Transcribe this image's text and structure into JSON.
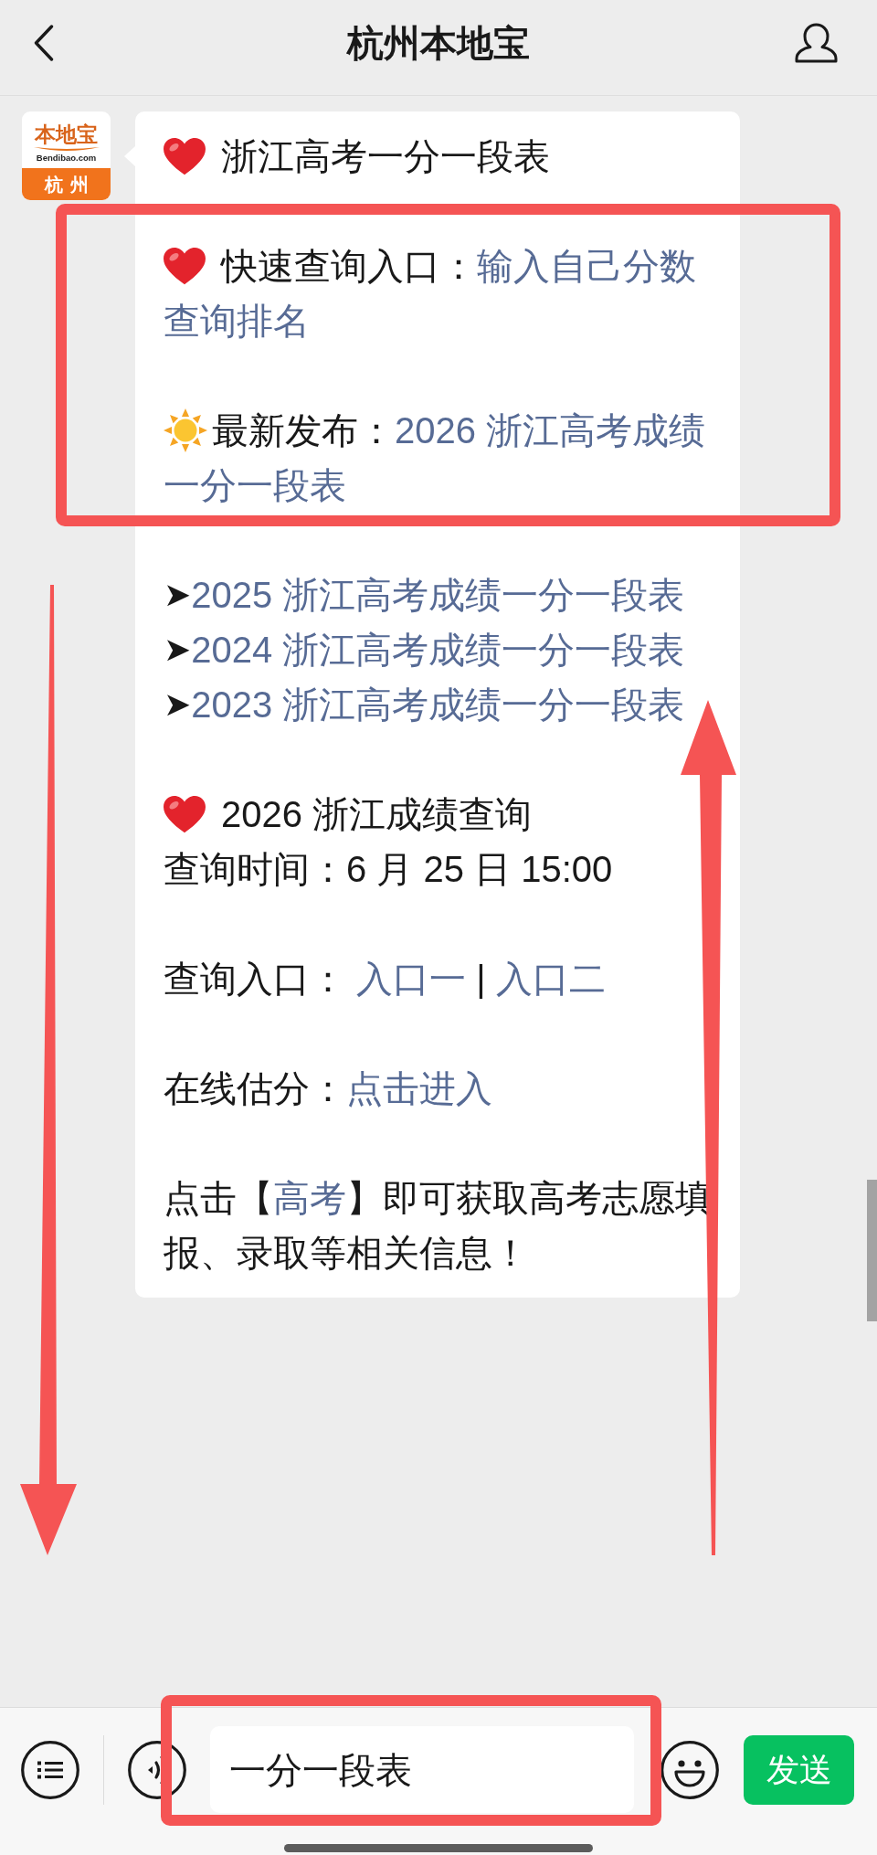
{
  "nav_bar": {
    "title": "杭州本地宝"
  },
  "chat": {
    "sender_avatar": {
      "brand": "本地宝",
      "domain": "Bendibao.com",
      "city": "杭州"
    },
    "message": {
      "paragraphs": [
        {
          "lines": [
            {
              "kind": "heart",
              "segments": [
                {
                  "text": "浙江高考一分一段表",
                  "link": false
                }
              ]
            }
          ]
        },
        {
          "lines": [
            {
              "kind": "heart",
              "segments": [
                {
                  "text": "快速查询入口：",
                  "link": false
                },
                {
                  "text": "输入自己分数",
                  "link": true
                }
              ]
            },
            {
              "kind": "plain",
              "segments": [
                {
                  "text": "查询排名",
                  "link": true
                }
              ]
            }
          ]
        },
        {
          "lines": [
            {
              "kind": "sun",
              "segments": [
                {
                  "text": "最新发布：",
                  "link": false
                },
                {
                  "text": "2026 浙江高考成绩",
                  "link": true
                }
              ]
            },
            {
              "kind": "plain",
              "segments": [
                {
                  "text": "一分一段表",
                  "link": true
                }
              ]
            }
          ]
        },
        {
          "lines": [
            {
              "kind": "bullet",
              "bullet": "➤",
              "segments": [
                {
                  "text": "2025 浙江高考成绩一分一段表",
                  "link": true
                }
              ]
            },
            {
              "kind": "bullet",
              "bullet": "➤",
              "segments": [
                {
                  "text": "2024 浙江高考成绩一分一段表",
                  "link": true
                }
              ]
            },
            {
              "kind": "bullet",
              "bullet": "➤",
              "segments": [
                {
                  "text": "2023 浙江高考成绩一分一段表",
                  "link": true
                }
              ]
            }
          ]
        },
        {
          "lines": [
            {
              "kind": "heart",
              "segments": [
                {
                  "text": "2026 浙江成绩查询",
                  "link": false
                }
              ]
            },
            {
              "kind": "plain",
              "segments": [
                {
                  "text": "查询时间：6 月 25 日 15:00",
                  "link": false
                }
              ]
            }
          ]
        },
        {
          "lines": [
            {
              "kind": "plain",
              "segments": [
                {
                  "text": "查询入口： ",
                  "link": false
                },
                {
                  "text": "入口一",
                  "link": true
                },
                {
                  "text": " | ",
                  "link": false
                },
                {
                  "text": "入口二",
                  "link": true
                }
              ]
            }
          ]
        },
        {
          "lines": [
            {
              "kind": "plain",
              "segments": [
                {
                  "text": "在线估分：",
                  "link": false
                },
                {
                  "text": "点击进入",
                  "link": true
                }
              ]
            }
          ]
        },
        {
          "lines": [
            {
              "kind": "plain",
              "segments": [
                {
                  "text": "点击【",
                  "link": false
                },
                {
                  "text": "高考",
                  "link": true
                },
                {
                  "text": "】即可获取高考志愿填",
                  "link": false
                }
              ]
            },
            {
              "kind": "plain",
              "segments": [
                {
                  "text": "报、录取等相关信息！",
                  "link": false
                }
              ]
            }
          ]
        }
      ]
    }
  },
  "input_bar": {
    "message_input": {
      "value": "一分一段表"
    },
    "send_button": {
      "label": "发送"
    }
  }
}
